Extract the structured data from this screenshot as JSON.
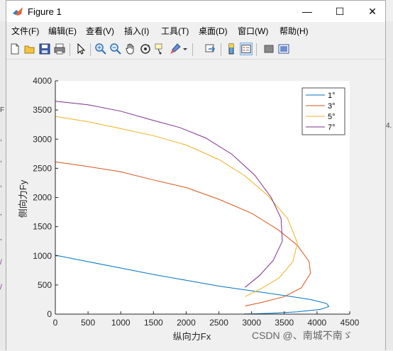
{
  "window": {
    "title": "Figure 1",
    "minimize": "—",
    "maximize": "☐",
    "close": "✕"
  },
  "menu": [
    "文件(F)",
    "编辑(E)",
    "查看(V)",
    "插入(I)",
    "工具(T)",
    "桌面(D)",
    "窗口(W)",
    "帮助(H)"
  ],
  "toolbar_icons": [
    "new-figure-icon",
    "open-file-icon",
    "save-icon",
    "print-icon",
    "pointer-icon",
    "zoom-in-icon",
    "zoom-out-icon",
    "pan-icon",
    "rotate-3d-icon",
    "data-cursor-icon",
    "brush-icon",
    "link-plot-icon",
    "colorbar-icon",
    "legend-icon",
    "hide-plot-tools-icon",
    "show-plot-tools-icon"
  ],
  "edge_text": {
    "left": [
      "F",
      ",",
      ",",
      ",",
      ",",
      ",",
      "/",
      "/"
    ],
    "right": "4."
  },
  "chart_data": {
    "type": "line",
    "xlabel": "纵向力Fx",
    "ylabel": "侧向力Fy",
    "xlim": [
      0,
      4500
    ],
    "ylim": [
      0,
      4000
    ],
    "xticks": [
      "0",
      "500",
      "1000",
      "1500",
      "2000",
      "2500",
      "3000",
      "3500",
      "4000",
      "4500"
    ],
    "yticks": [
      "0",
      "500",
      "1000",
      "1500",
      "2000",
      "2500",
      "3000",
      "3500",
      "4000"
    ],
    "legend_position": "top-right",
    "grid": false,
    "series": [
      {
        "name": "1°",
        "color": "#0072BD",
        "points": [
          [
            0,
            1010
          ],
          [
            500,
            900
          ],
          [
            1000,
            790
          ],
          [
            1500,
            680
          ],
          [
            2000,
            580
          ],
          [
            2500,
            480
          ],
          [
            3000,
            400
          ],
          [
            3500,
            320
          ],
          [
            3900,
            250
          ],
          [
            4150,
            180
          ],
          [
            4180,
            130
          ],
          [
            4050,
            80
          ],
          [
            3700,
            40
          ],
          [
            3300,
            15
          ],
          [
            3000,
            5
          ],
          [
            2880,
            2
          ]
        ]
      },
      {
        "name": "3°",
        "color": "#D95319",
        "points": [
          [
            0,
            2610
          ],
          [
            500,
            2530
          ],
          [
            1000,
            2440
          ],
          [
            1500,
            2300
          ],
          [
            2000,
            2170
          ],
          [
            2500,
            1970
          ],
          [
            3000,
            1730
          ],
          [
            3400,
            1450
          ],
          [
            3700,
            1180
          ],
          [
            3880,
            900
          ],
          [
            3900,
            700
          ],
          [
            3760,
            450
          ],
          [
            3500,
            300
          ],
          [
            3150,
            200
          ],
          [
            2900,
            140
          ]
        ]
      },
      {
        "name": "5°",
        "color": "#EDB120",
        "points": [
          [
            0,
            3390
          ],
          [
            500,
            3300
          ],
          [
            1000,
            3180
          ],
          [
            1500,
            3060
          ],
          [
            2000,
            2900
          ],
          [
            2500,
            2650
          ],
          [
            2900,
            2370
          ],
          [
            3250,
            2030
          ],
          [
            3550,
            1640
          ],
          [
            3700,
            1220
          ],
          [
            3630,
            900
          ],
          [
            3420,
            620
          ],
          [
            3150,
            440
          ],
          [
            2900,
            300
          ]
        ]
      },
      {
        "name": "7°",
        "color": "#7E2F8E",
        "points": [
          [
            0,
            3650
          ],
          [
            500,
            3590
          ],
          [
            1000,
            3480
          ],
          [
            1500,
            3320
          ],
          [
            1900,
            3200
          ],
          [
            2300,
            3020
          ],
          [
            2700,
            2740
          ],
          [
            3050,
            2380
          ],
          [
            3300,
            2000
          ],
          [
            3450,
            1640
          ],
          [
            3470,
            1250
          ],
          [
            3330,
            920
          ],
          [
            3120,
            660
          ],
          [
            2900,
            460
          ]
        ]
      }
    ]
  },
  "watermark": "CSDN @、南城不南ゞ"
}
